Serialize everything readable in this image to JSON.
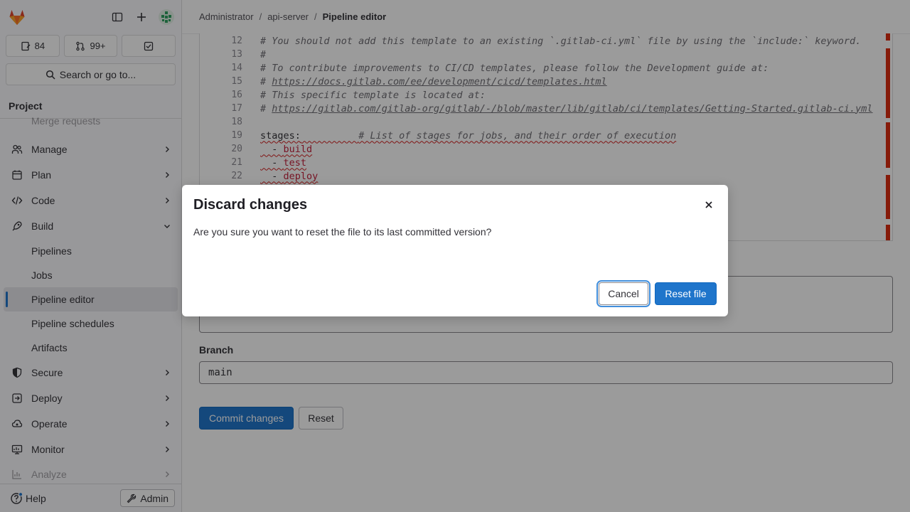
{
  "breadcrumb": {
    "items": [
      "Administrator",
      "api-server"
    ],
    "current": "Pipeline editor",
    "separator": "/"
  },
  "sidebar": {
    "counts": {
      "issues": "84",
      "merge_requests": "99+"
    },
    "search_label": "Search or go to...",
    "section": "Project",
    "faded_top": "Merge requests",
    "items": [
      {
        "label": "Manage",
        "icon": "users-icon"
      },
      {
        "label": "Plan",
        "icon": "calendar-icon"
      },
      {
        "label": "Code",
        "icon": "code-icon"
      },
      {
        "label": "Build",
        "icon": "rocket-icon",
        "expanded": true
      }
    ],
    "build_sub": [
      "Pipelines",
      "Jobs",
      "Pipeline editor",
      "Pipeline schedules",
      "Artifacts"
    ],
    "items_after": [
      {
        "label": "Secure",
        "icon": "shield-icon"
      },
      {
        "label": "Deploy",
        "icon": "deploy-icon"
      },
      {
        "label": "Operate",
        "icon": "cloud-icon"
      },
      {
        "label": "Monitor",
        "icon": "monitor-icon"
      }
    ],
    "faded_bottom": "Analyze",
    "help": "Help",
    "admin": "Admin"
  },
  "editor": {
    "lines": [
      {
        "n": "12",
        "text": "# You should not add this template to an existing `.gitlab-ci.yml` file by using the `include:` keyword."
      },
      {
        "n": "13",
        "text": "#"
      },
      {
        "n": "14",
        "text": "# To contribute improvements to CI/CD templates, please follow the Development guide at:"
      },
      {
        "n": "15",
        "prefix": "# ",
        "link": "https://docs.gitlab.com/ee/development/cicd/templates.html"
      },
      {
        "n": "16",
        "text": "# This specific template is located at:"
      },
      {
        "n": "17",
        "prefix": "# ",
        "link": "https://gitlab.com/gitlab-org/gitlab/-/blob/master/lib/gitlab/ci/templates/Getting-Started.gitlab-ci.yml"
      },
      {
        "n": "18",
        "text": ""
      },
      {
        "n": "19",
        "key": "stages:",
        "comment": "# List of stages for jobs, and their order of execution"
      },
      {
        "n": "20",
        "item": "build"
      },
      {
        "n": "21",
        "item": "test"
      },
      {
        "n": "22",
        "item": "deploy"
      }
    ]
  },
  "form": {
    "branch_label": "Branch",
    "branch_value": "main",
    "commit_label": "Commit changes",
    "reset_label": "Reset"
  },
  "modal": {
    "title": "Discard changes",
    "body": "Are you sure you want to reset the file to its last committed version?",
    "cancel": "Cancel",
    "confirm": "Reset file"
  }
}
